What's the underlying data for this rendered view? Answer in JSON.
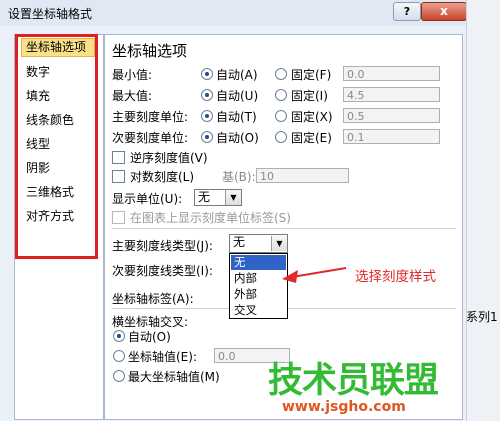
{
  "window": {
    "title": "设置坐标轴格式",
    "help": "?",
    "close": "x"
  },
  "nav": {
    "items": [
      "坐标轴选项",
      "数字",
      "填充",
      "线条颜色",
      "线型",
      "阴影",
      "三维格式",
      "对齐方式"
    ]
  },
  "panel": {
    "title": "坐标轴选项",
    "rows": [
      {
        "label": "最小值:",
        "auto": "自动(A)",
        "fixed": "固定(F)",
        "value": "0.0"
      },
      {
        "label": "最大值:",
        "auto": "自动(U)",
        "fixed": "固定(I)",
        "value": "4.5"
      },
      {
        "label": "主要刻度单位:",
        "auto": "自动(T)",
        "fixed": "固定(X)",
        "value": "0.5"
      },
      {
        "label": "次要刻度单位:",
        "auto": "自动(O)",
        "fixed": "固定(E)",
        "value": "0.1"
      }
    ],
    "reverse": "逆序刻度值(V)",
    "log": "对数刻度(L)",
    "log_base_label": "基(B):",
    "log_base_value": "10",
    "display_units_label": "显示单位(U):",
    "display_units_value": "无",
    "show_units_label": "在图表上显示刻度单位标签(S)",
    "major_tick_label": "主要刻度线类型(J):",
    "major_tick_value": "无",
    "minor_tick_label": "次要刻度线类型(I):",
    "axis_labels_label": "坐标轴标签(A):",
    "dropdown_options": [
      "无",
      "内部",
      "外部",
      "交叉"
    ],
    "cross_title": "横坐标轴交叉:",
    "cross_auto": "自动(O)",
    "cross_value": "坐标轴值(E):",
    "cross_value_input": "0.0",
    "cross_max": "最大坐标轴值(M)"
  },
  "annotation": "选择刻度样式",
  "watermark": {
    "text": "技术员联盟",
    "url": "www.jsgho.com"
  },
  "background": {
    "series_text": "系列1"
  },
  "colors": {
    "highlight": "#e02020",
    "selection": "#fbe08a",
    "dropdown_hl": "#3162c6"
  }
}
